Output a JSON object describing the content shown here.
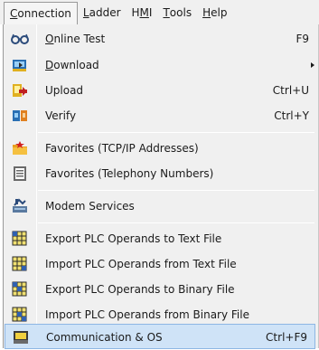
{
  "menubar": {
    "items": [
      {
        "pre": "",
        "ul": "C",
        "post": "onnection"
      },
      {
        "pre": "",
        "ul": "L",
        "post": "adder"
      },
      {
        "pre": "H",
        "ul": "M",
        "post": "I"
      },
      {
        "pre": "",
        "ul": "T",
        "post": "ools"
      },
      {
        "pre": "",
        "ul": "H",
        "post": "elp"
      }
    ]
  },
  "menu": {
    "online_test": {
      "ul": "O",
      "rest": "nline Test",
      "shortcut": "F9",
      "icon": "glasses-icon"
    },
    "download": {
      "ul": "D",
      "rest": "ownload",
      "icon": "download-icon"
    },
    "upload": {
      "label": "Upload",
      "shortcut": "Ctrl+U",
      "icon": "upload-icon"
    },
    "verify": {
      "label": "Verify",
      "shortcut": "Ctrl+Y",
      "icon": "verify-icon"
    },
    "fav_tcp": {
      "label": "Favorites (TCP/IP Addresses)",
      "icon": "folder-star-icon"
    },
    "fav_tel": {
      "label": "Favorites (Telephony Numbers)",
      "icon": "phone-book-icon"
    },
    "modem": {
      "label": "Modem Services",
      "icon": "modem-icon"
    },
    "export_text": {
      "label": "Export PLC Operands to Text File",
      "icon": "grid-export-icon"
    },
    "import_text": {
      "label": "Import PLC Operands from Text File",
      "icon": "grid-import-icon"
    },
    "export_bin": {
      "label": "Export PLC Operands to Binary File",
      "icon": "grid-export-icon"
    },
    "import_bin": {
      "label": "Import PLC Operands from Binary File",
      "icon": "grid-import-icon"
    },
    "comm_os": {
      "label": "Communication & OS",
      "shortcut": "Ctrl+F9",
      "icon": "communication-icon"
    }
  }
}
